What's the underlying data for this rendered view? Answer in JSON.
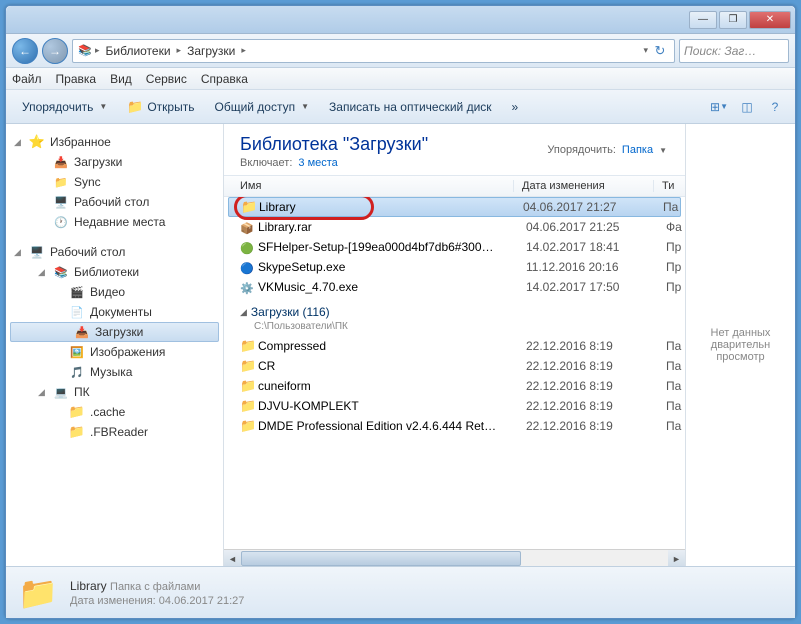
{
  "titlebar": {
    "min": "—",
    "max": "❐",
    "close": "✕"
  },
  "nav": {
    "back": "←",
    "fwd": "→",
    "bc_root_icon": "▸",
    "bc_libraries": "Библиотеки",
    "bc_downloads": "Загрузки",
    "refresh": "↻",
    "search_placeholder": "Поиск: Заг…"
  },
  "menu": {
    "file": "Файл",
    "edit": "Правка",
    "view": "Вид",
    "tools": "Сервис",
    "help": "Справка"
  },
  "toolbar": {
    "organize": "Упорядочить",
    "open": "Открыть",
    "share": "Общий доступ",
    "burn": "Записать на оптический диск",
    "chevrons": "»"
  },
  "sidebar": {
    "favorites": "Избранное",
    "fav_items": [
      {
        "icon": "ic-dl",
        "label": "Загрузки"
      },
      {
        "icon": "ic-sync",
        "label": "Sync"
      },
      {
        "icon": "ic-desktop",
        "label": "Рабочий стол"
      },
      {
        "icon": "ic-clock",
        "label": "Недавние места"
      }
    ],
    "desktop": "Рабочий стол",
    "libraries": "Библиотеки",
    "lib_items": [
      {
        "icon": "ic-video",
        "label": "Видео"
      },
      {
        "icon": "ic-doc",
        "label": "Документы"
      },
      {
        "icon": "ic-dl",
        "label": "Загрузки",
        "selected": true
      },
      {
        "icon": "ic-img",
        "label": "Изображения"
      },
      {
        "icon": "ic-music",
        "label": "Музыка"
      }
    ],
    "pc": "ПК",
    "pc_items": [
      {
        "icon": "ic-folder",
        "label": ".cache"
      },
      {
        "icon": "ic-folder",
        "label": ".FBReader"
      }
    ]
  },
  "library": {
    "title": "Библиотека \"Загрузки\"",
    "includes_label": "Включает:",
    "includes_link": "3 места",
    "sort_label": "Упорядочить:",
    "sort_value": "Папка"
  },
  "columns": {
    "name": "Имя",
    "date": "Дата изменения",
    "type": "Ти"
  },
  "files_top": [
    {
      "icon": "ic-folder",
      "name": "Library",
      "date": "04.06.2017 21:27",
      "type": "Па",
      "selected": true
    },
    {
      "icon": "ic-rar",
      "name": "Library.rar",
      "date": "04.06.2017 21:25",
      "type": "Фа"
    },
    {
      "icon": "ic-app",
      "name": "SFHelper-Setup-[199ea000d4bf7db6#300…",
      "date": "14.02.2017 18:41",
      "type": "Пр"
    },
    {
      "icon": "ic-skype",
      "name": "SkypeSetup.exe",
      "date": "11.12.2016 20:16",
      "type": "Пр"
    },
    {
      "icon": "ic-exe",
      "name": "VKMusic_4.70.exe",
      "date": "14.02.2017 17:50",
      "type": "Пр"
    }
  ],
  "group2": {
    "title": "Загрузки (116)",
    "path": "C:\\Пользователи\\ПК"
  },
  "files_bottom": [
    {
      "icon": "ic-folder",
      "name": "Compressed",
      "date": "22.12.2016 8:19",
      "type": "Па"
    },
    {
      "icon": "ic-folder",
      "name": "CR",
      "date": "22.12.2016 8:19",
      "type": "Па"
    },
    {
      "icon": "ic-folder",
      "name": "cuneiform",
      "date": "22.12.2016 8:19",
      "type": "Па"
    },
    {
      "icon": "ic-folder",
      "name": "DJVU-KOMPLEKT",
      "date": "22.12.2016 8:19",
      "type": "Па"
    },
    {
      "icon": "ic-folder",
      "name": "DMDE Professional Edition v2.4.6.444 Ret…",
      "date": "22.12.2016 8:19",
      "type": "Па"
    }
  ],
  "preview": {
    "text": "Нет данных дварительн просмотр"
  },
  "status": {
    "name": "Library",
    "type": "Папка с файлами",
    "date_label": "Дата изменения:",
    "date": "04.06.2017 21:27"
  }
}
